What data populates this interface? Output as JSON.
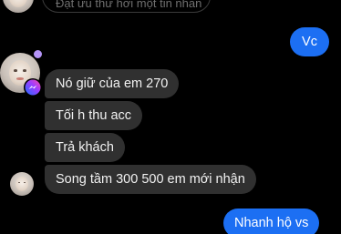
{
  "input": {
    "placeholder": "Đặt ưu thư hơi một tin nhắn"
  },
  "messages": {
    "outgoing_1": "Vc",
    "incoming_1": "Nó giữ của em 270",
    "incoming_2": "Tối h thu acc",
    "incoming_3": "Trả khách",
    "incoming_4": "Song tầm 300 500 em mới nhận",
    "outgoing_2": "Nhanh hộ vs"
  },
  "icons": {
    "badge": "messenger-icon",
    "online": "online-status-icon"
  },
  "colors": {
    "background": "#000000",
    "incoming_bubble": "#303030",
    "outgoing_bubble": "#1c6ff3",
    "messenger_gradient_start": "#1f6cff",
    "messenger_gradient_end": "#ff4aa1",
    "online_dot": "#b594f7"
  }
}
